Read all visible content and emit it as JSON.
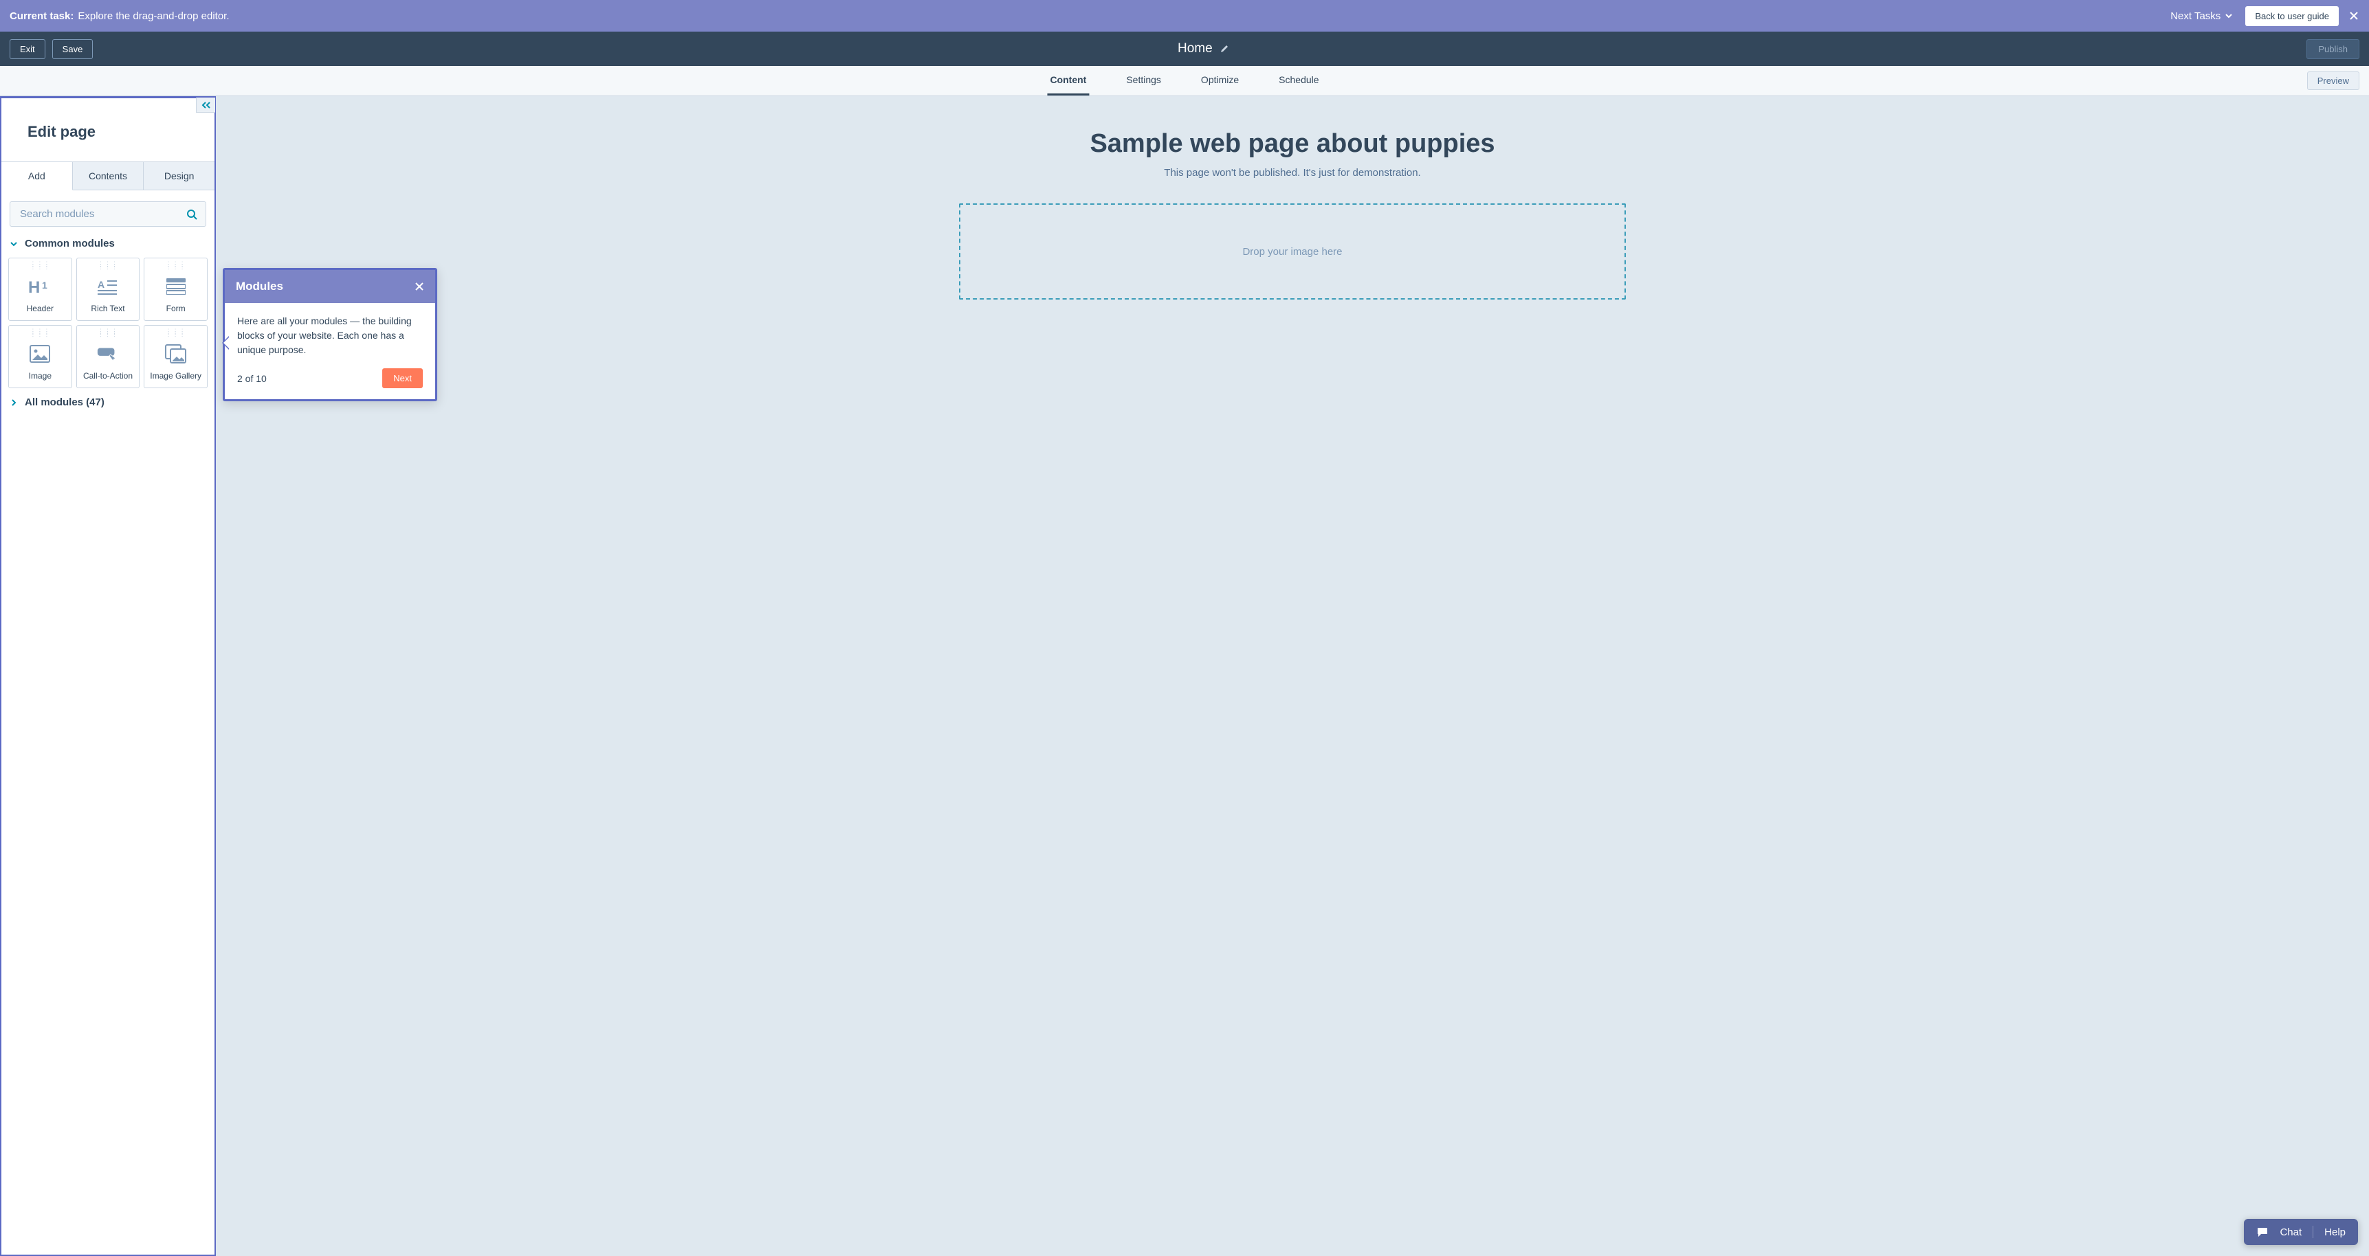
{
  "taskbar": {
    "label_prefix": "Current task:",
    "task": "Explore the drag-and-drop editor.",
    "next_tasks": "Next Tasks",
    "back": "Back to user guide"
  },
  "header": {
    "exit": "Exit",
    "save": "Save",
    "title": "Home",
    "publish": "Publish"
  },
  "tabs": {
    "content": "Content",
    "settings": "Settings",
    "optimize": "Optimize",
    "schedule": "Schedule",
    "preview": "Preview"
  },
  "sidebar": {
    "title": "Edit page",
    "tabs": {
      "add": "Add",
      "contents": "Contents",
      "design": "Design"
    },
    "search_placeholder": "Search modules",
    "common_header": "Common modules",
    "all_header": "All modules (47)",
    "modules": {
      "header": "Header",
      "rich_text": "Rich Text",
      "form": "Form",
      "image": "Image",
      "cta": "Call-to-Action",
      "gallery": "Image Gallery"
    }
  },
  "canvas": {
    "heading": "Sample web page about puppies",
    "subtitle": "This page won't be published. It's just for demonstration.",
    "dropzone": "Drop your image here"
  },
  "popover": {
    "title": "Modules",
    "body": "Here are all your modules — the building blocks of your website. Each one has a unique purpose.",
    "step": "2 of 10",
    "next": "Next"
  },
  "help": {
    "chat": "Chat",
    "help": "Help"
  }
}
